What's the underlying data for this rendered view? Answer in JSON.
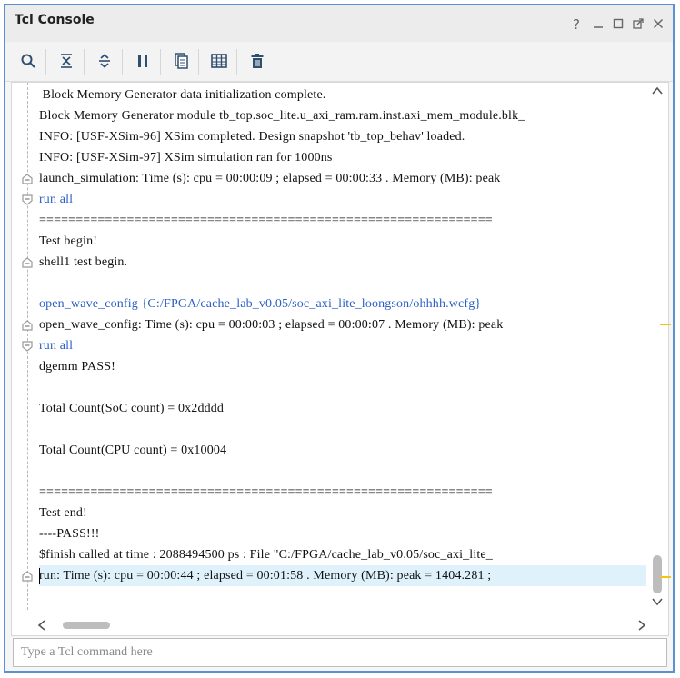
{
  "window": {
    "title": "Tcl Console",
    "controls": {
      "help": "?",
      "minimize": "—",
      "maximize": "☐",
      "restore": "⤢",
      "close": "✕"
    }
  },
  "toolbar": {
    "icons": [
      "search-icon",
      "collapse-all-icon",
      "expand-all-icon",
      "pause-icon",
      "copy-icon",
      "columns-icon",
      "trash-icon"
    ]
  },
  "console": {
    "lines": [
      {
        "text": " Block Memory Generator data initialization complete.",
        "type": "output"
      },
      {
        "text": "Block Memory Generator module tb_top.soc_lite.u_axi_ram.ram.inst.axi_mem_module.blk_",
        "type": "output"
      },
      {
        "text": "INFO: [USF-XSim-96] XSim completed. Design snapshot 'tb_top_behav' loaded.",
        "type": "output"
      },
      {
        "text": "INFO: [USF-XSim-97] XSim simulation ran for 1000ns",
        "type": "output"
      },
      {
        "text": "launch_simulation: Time (s): cpu = 00:00:09 ; elapsed = 00:00:33 . Memory (MB): peak",
        "type": "output",
        "fold": "end"
      },
      {
        "text": "run all",
        "type": "command",
        "fold": "start"
      },
      {
        "text": "==============================================================",
        "type": "output"
      },
      {
        "text": "Test begin!",
        "type": "output"
      },
      {
        "text": "shell1 test begin.",
        "type": "output",
        "fold": "end"
      },
      {
        "text": "",
        "type": "output"
      },
      {
        "text": "open_wave_config {C:/FPGA/cache_lab_v0.05/soc_axi_lite_loongson/ohhhh.wcfg}",
        "type": "command"
      },
      {
        "text": "open_wave_config: Time (s): cpu = 00:00:03 ; elapsed = 00:00:07 . Memory (MB): peak",
        "type": "output",
        "fold": "end"
      },
      {
        "text": "run all",
        "type": "command",
        "fold": "start"
      },
      {
        "text": "dgemm PASS!",
        "type": "output"
      },
      {
        "text": "",
        "type": "output"
      },
      {
        "text": "Total Count(SoC count) = 0x2dddd",
        "type": "output"
      },
      {
        "text": "",
        "type": "output"
      },
      {
        "text": "Total Count(CPU count) = 0x10004",
        "type": "output"
      },
      {
        "text": "",
        "type": "output"
      },
      {
        "text": "==============================================================",
        "type": "output"
      },
      {
        "text": "Test end!",
        "type": "output"
      },
      {
        "text": "----PASS!!!",
        "type": "output"
      },
      {
        "text": "$finish called at time : 2088494500 ps : File \"C:/FPGA/cache_lab_v0.05/soc_axi_lite_",
        "type": "output"
      },
      {
        "text": "run: Time (s): cpu = 00:00:44 ; elapsed = 00:01:58 . Memory (MB): peak = 1404.281 ;",
        "type": "output",
        "fold": "end",
        "highlighted": true
      }
    ]
  },
  "input": {
    "placeholder": "Type a Tcl command here",
    "value": ""
  },
  "colors": {
    "command": "#2a5fc6",
    "highlight": "#dff2fb",
    "border_accent": "#5b8fd6",
    "marker": "#f0c419"
  }
}
